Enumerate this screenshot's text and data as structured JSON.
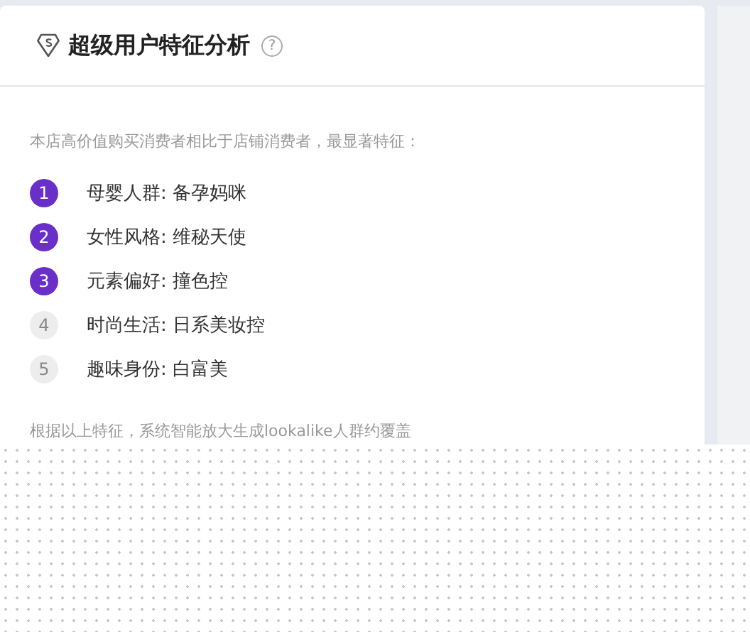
{
  "card": {
    "title": "超级用户特征分析",
    "help": "?",
    "intro": "本店高价值购买消费者相比于店铺消费者，最显著特征：",
    "features": [
      {
        "rank": "1",
        "text": "母婴人群: 备孕妈咪",
        "highlighted": true
      },
      {
        "rank": "2",
        "text": "女性风格: 维秘天使",
        "highlighted": true
      },
      {
        "rank": "3",
        "text": "元素偏好: 撞色控",
        "highlighted": true
      },
      {
        "rank": "4",
        "text": "时尚生活: 日系美妆控",
        "highlighted": false
      },
      {
        "rank": "5",
        "text": "趣味身份: 白富美",
        "highlighted": false
      }
    ],
    "footer": "根据以上特征，系统智能放大生成lookalike人群约覆盖"
  }
}
